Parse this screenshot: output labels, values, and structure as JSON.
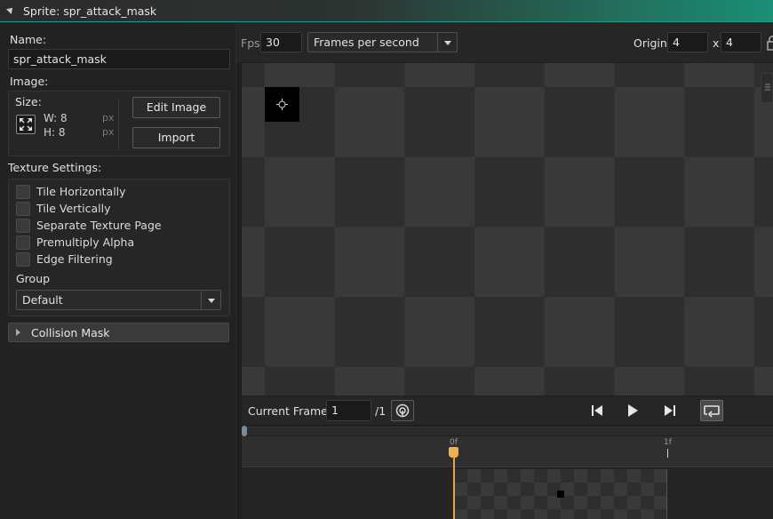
{
  "window": {
    "title": "Sprite: spr_attack_mask"
  },
  "properties": {
    "name_label": "Name:",
    "name_value": "spr_attack_mask",
    "image_label": "Image:",
    "size_label": "Size:",
    "width_text": "W: 8",
    "height_text": "H: 8",
    "unit_w": "px",
    "unit_h": "px",
    "edit_image_label": "Edit Image",
    "import_label": "Import",
    "texture_settings_label": "Texture Settings:",
    "texture_options": [
      {
        "label": "Tile Horizontally",
        "checked": false
      },
      {
        "label": "Tile Vertically",
        "checked": false
      },
      {
        "label": "Separate Texture Page",
        "checked": false
      },
      {
        "label": "Premultiply Alpha",
        "checked": false
      },
      {
        "label": "Edge Filtering",
        "checked": false
      }
    ],
    "group_label": "Group",
    "group_value": "Default",
    "collision_mask_label": "Collision Mask"
  },
  "toolbar": {
    "fps_label": "Fps",
    "fps_value": "30",
    "fps_mode": "Frames per second",
    "origin_label": "Origin",
    "origin_x": "4",
    "origin_sep": "x",
    "origin_y": "4"
  },
  "playback": {
    "current_frame_label": "Current Frame:",
    "current_frame_value": "1",
    "frame_total": "/1"
  },
  "timeline": {
    "label_0": "0f",
    "label_1": "1f"
  },
  "colors": {
    "accent": "#1a8f76",
    "playhead": "#f0b04e",
    "loop_active": "#4a4a4a"
  }
}
